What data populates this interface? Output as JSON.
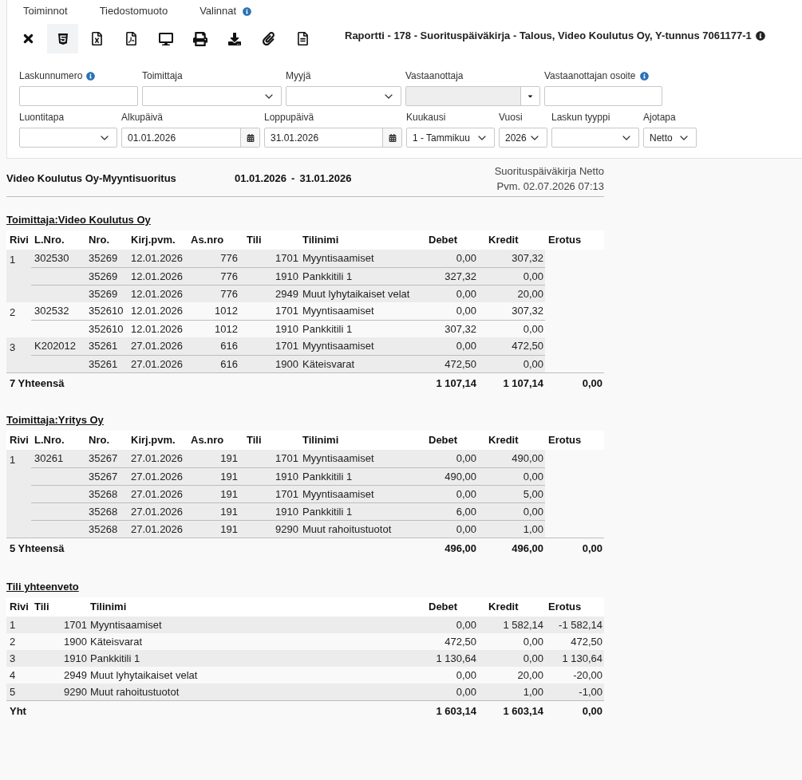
{
  "menu": [
    {
      "label": "Toiminnot",
      "info": false
    },
    {
      "label": "Tiedostomuoto",
      "info": false
    },
    {
      "label": "Valinnat",
      "info": true
    }
  ],
  "toolbar": [
    {
      "kind": "close",
      "selected": false
    },
    {
      "kind": "html",
      "selected": true
    },
    {
      "kind": "excel",
      "selected": false
    },
    {
      "kind": "pdf",
      "selected": false
    },
    {
      "kind": "screen",
      "selected": false
    },
    {
      "kind": "print",
      "selected": false
    },
    {
      "kind": "download",
      "selected": false
    },
    {
      "kind": "attachment",
      "selected": false
    },
    {
      "kind": "document",
      "selected": false
    }
  ],
  "report_title": {
    "text": "Raportti - 178 - Suorituspäiväkirja - Talous, Video Koulutus Oy, Y-tunnus 7061177-1",
    "info": true
  },
  "filters": [
    [
      {
        "label": "Laskunnumero",
        "kind": "text",
        "info": true,
        "disabled": false
      },
      {
        "label": "Toimittaja",
        "kind": "select",
        "info": false,
        "disabled": false
      },
      {
        "label": "Myyjä",
        "kind": "select",
        "info": false,
        "disabled": false
      },
      {
        "label": "Vastaanottaja",
        "kind": "combo",
        "info": false,
        "disabled": true
      },
      {
        "label": "Vastaanottajan osoite",
        "kind": "text",
        "info": true,
        "disabled": false
      }
    ],
    [
      {
        "label": "Luontitapa",
        "kind": "select",
        "info": false,
        "disabled": false
      },
      {
        "label": "Alkupäivä",
        "kind": "date",
        "info": false,
        "disabled": false,
        "value": "01.01.2026"
      },
      {
        "label": "Loppupäivä",
        "kind": "date",
        "info": false,
        "disabled": false,
        "value": "31.01.2026"
      },
      {
        "label": "Kuukausi",
        "kind": "select",
        "info": false,
        "disabled": false,
        "value": "1 - Tammikuu"
      },
      {
        "label": "Vuosi",
        "kind": "select",
        "info": false,
        "disabled": false,
        "value": "2026"
      },
      {
        "label": "Laskun tyyppi",
        "kind": "select",
        "info": false,
        "disabled": false
      },
      {
        "label": "Ajotapa",
        "kind": "select",
        "info": false,
        "disabled": false,
        "value": "Netto"
      }
    ]
  ],
  "report": {
    "title": "Video Koulutus Oy-Myyntisuoritus",
    "period_start": "01.01.2026",
    "period_separator": "-",
    "period_end": "31.01.2026",
    "type": "Suorituspäiväkirja Netto",
    "printed": "Pvm. 02.07.2026 07:13"
  },
  "sections": [
    {
      "title": "Toimittaja:Video Koulutus Oy",
      "columns": [
        "Rivi",
        "L.Nro.",
        "Nro.",
        "Kirj.pvm.",
        "As.nro",
        "Tili",
        "Tilinimi",
        "Debet",
        "Kredit",
        "Erotus"
      ],
      "groups": [
        {
          "row_no": "1",
          "l_nro": "302530",
          "entries": [
            {
              "nro": "35269",
              "date": "12.01.2026",
              "as_nro": "776",
              "tili": "1701",
              "tilinimi": "Myyntisaamiset",
              "debet": "0,00",
              "kredit": "307,32"
            },
            {
              "nro": "35269",
              "date": "12.01.2026",
              "as_nro": "776",
              "tili": "1910",
              "tilinimi": "Pankkitili 1",
              "debet": "327,32",
              "kredit": "0,00"
            },
            {
              "nro": "35269",
              "date": "12.01.2026",
              "as_nro": "776",
              "tili": "2949",
              "tilinimi": "Muut lyhytaikaiset velat",
              "debet": "0,00",
              "kredit": "20,00"
            }
          ]
        },
        {
          "row_no": "2",
          "l_nro": "302532",
          "entries": [
            {
              "nro": "352610",
              "date": "12.01.2026",
              "as_nro": "1012",
              "tili": "1701",
              "tilinimi": "Myyntisaamiset",
              "debet": "0,00",
              "kredit": "307,32"
            },
            {
              "nro": "352610",
              "date": "12.01.2026",
              "as_nro": "1012",
              "tili": "1910",
              "tilinimi": "Pankkitili 1",
              "debet": "307,32",
              "kredit": "0,00"
            }
          ]
        },
        {
          "row_no": "3",
          "l_nro": "K202012",
          "entries": [
            {
              "nro": "35261",
              "date": "27.01.2026",
              "as_nro": "616",
              "tili": "1701",
              "tilinimi": "Myyntisaamiset",
              "debet": "0,00",
              "kredit": "472,50"
            },
            {
              "nro": "35261",
              "date": "27.01.2026",
              "as_nro": "616",
              "tili": "1900",
              "tilinimi": "Käteisvarat",
              "debet": "472,50",
              "kredit": "0,00"
            }
          ]
        }
      ],
      "total": {
        "label": "7 Yhteensä",
        "debet": "1 107,14",
        "kredit": "1 107,14",
        "erotus": "0,00"
      }
    },
    {
      "title": "Toimittaja:Yritys Oy",
      "columns": [
        "Rivi",
        "L.Nro.",
        "Nro.",
        "Kirj.pvm.",
        "As.nro",
        "Tili",
        "Tilinimi",
        "Debet",
        "Kredit",
        "Erotus"
      ],
      "groups": [
        {
          "row_no": "1",
          "l_nro": "30261",
          "entries": [
            {
              "nro": "35267",
              "date": "27.01.2026",
              "as_nro": "191",
              "tili": "1701",
              "tilinimi": "Myyntisaamiset",
              "debet": "0,00",
              "kredit": "490,00"
            },
            {
              "nro": "35267",
              "date": "27.01.2026",
              "as_nro": "191",
              "tili": "1910",
              "tilinimi": "Pankkitili 1",
              "debet": "490,00",
              "kredit": "0,00"
            },
            {
              "nro": "35268",
              "date": "27.01.2026",
              "as_nro": "191",
              "tili": "1701",
              "tilinimi": "Myyntisaamiset",
              "debet": "0,00",
              "kredit": "5,00"
            },
            {
              "nro": "35268",
              "date": "27.01.2026",
              "as_nro": "191",
              "tili": "1910",
              "tilinimi": "Pankkitili 1",
              "debet": "6,00",
              "kredit": "0,00"
            },
            {
              "nro": "35268",
              "date": "27.01.2026",
              "as_nro": "191",
              "tili": "9290",
              "tilinimi": "Muut rahoitustuotot",
              "debet": "0,00",
              "kredit": "1,00"
            }
          ]
        }
      ],
      "total": {
        "label": "5 Yhteensä",
        "debet": "496,00",
        "kredit": "496,00",
        "erotus": "0,00"
      }
    }
  ],
  "summary": {
    "title": "Tili yhteenveto",
    "columns": [
      "Rivi",
      "Tili",
      "Tilinimi",
      "Debet",
      "Kredit",
      "Erotus"
    ],
    "rows": [
      {
        "rivi": "1",
        "tili": "1701",
        "tilinimi": "Myyntisaamiset",
        "debet": "0,00",
        "kredit": "1 582,14",
        "erotus": "-1 582,14"
      },
      {
        "rivi": "2",
        "tili": "1900",
        "tilinimi": "Käteisvarat",
        "debet": "472,50",
        "kredit": "0,00",
        "erotus": "472,50"
      },
      {
        "rivi": "3",
        "tili": "1910",
        "tilinimi": "Pankkitili 1",
        "debet": "1 130,64",
        "kredit": "0,00",
        "erotus": "1 130,64"
      },
      {
        "rivi": "4",
        "tili": "2949",
        "tilinimi": "Muut lyhytaikaiset velat",
        "debet": "0,00",
        "kredit": "20,00",
        "erotus": "-20,00"
      },
      {
        "rivi": "5",
        "tili": "9290",
        "tilinimi": "Muut rahoitustuotot",
        "debet": "0,00",
        "kredit": "1,00",
        "erotus": "-1,00"
      }
    ],
    "total": {
      "label": "Yht",
      "debet": "1 603,14",
      "kredit": "1 603,14",
      "erotus": "0,00"
    }
  }
}
